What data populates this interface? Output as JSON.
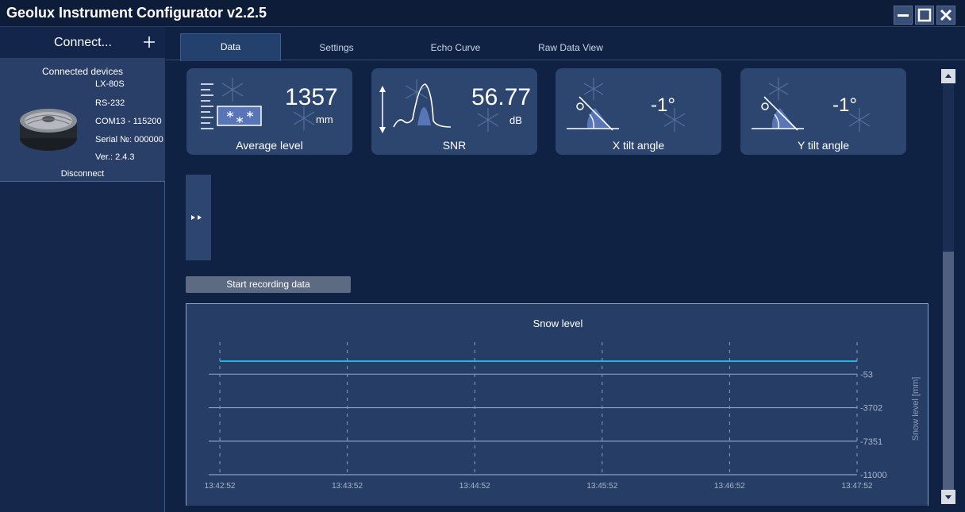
{
  "window": {
    "title": "Geolux Instrument Configurator v2.2.5"
  },
  "sidebar": {
    "connect_label": "Connect...",
    "connected_header": "Connected devices",
    "device": {
      "model": "LX-80S",
      "interface": "RS-232",
      "port": "COM13 - 115200",
      "serial": "Serial №: 000000",
      "version": "Ver.: 2.4.3"
    },
    "disconnect_label": "Disconnect"
  },
  "tabs": [
    "Data",
    "Settings",
    "Echo Curve",
    "Raw Data View"
  ],
  "cards": {
    "average_level": {
      "value": "1357",
      "unit": "mm",
      "label": "Average level"
    },
    "snr": {
      "value": "56.77",
      "unit": "dB",
      "label": "SNR"
    },
    "x_tilt": {
      "value": "-1°",
      "label": "X tilt angle"
    },
    "y_tilt": {
      "value": "-1°",
      "label": "Y tilt angle"
    }
  },
  "record_button": "Start recording data",
  "colors": {
    "accent": "#25b4e6",
    "card": "#2c4670",
    "background": "#0f2244"
  },
  "chart_data": {
    "type": "line",
    "title": "Snow level",
    "ylabel": "Snow level [mm]",
    "x_ticks": [
      "13:42:52",
      "13:43:52",
      "13:44:52",
      "13:45:52",
      "13:46:52",
      "13:47:52"
    ],
    "y_ticks": [
      "-53",
      "-3702",
      "-7351",
      "-11000"
    ],
    "y_tick_values": [
      -53,
      -3702,
      -7351,
      -11000
    ],
    "ylim": [
      -11000,
      1357
    ],
    "series": [
      {
        "x": [
          "13:42:52",
          "13:47:52"
        ],
        "values": [
          1357,
          1357
        ],
        "color": "#25b4e6"
      }
    ],
    "grid": true
  }
}
